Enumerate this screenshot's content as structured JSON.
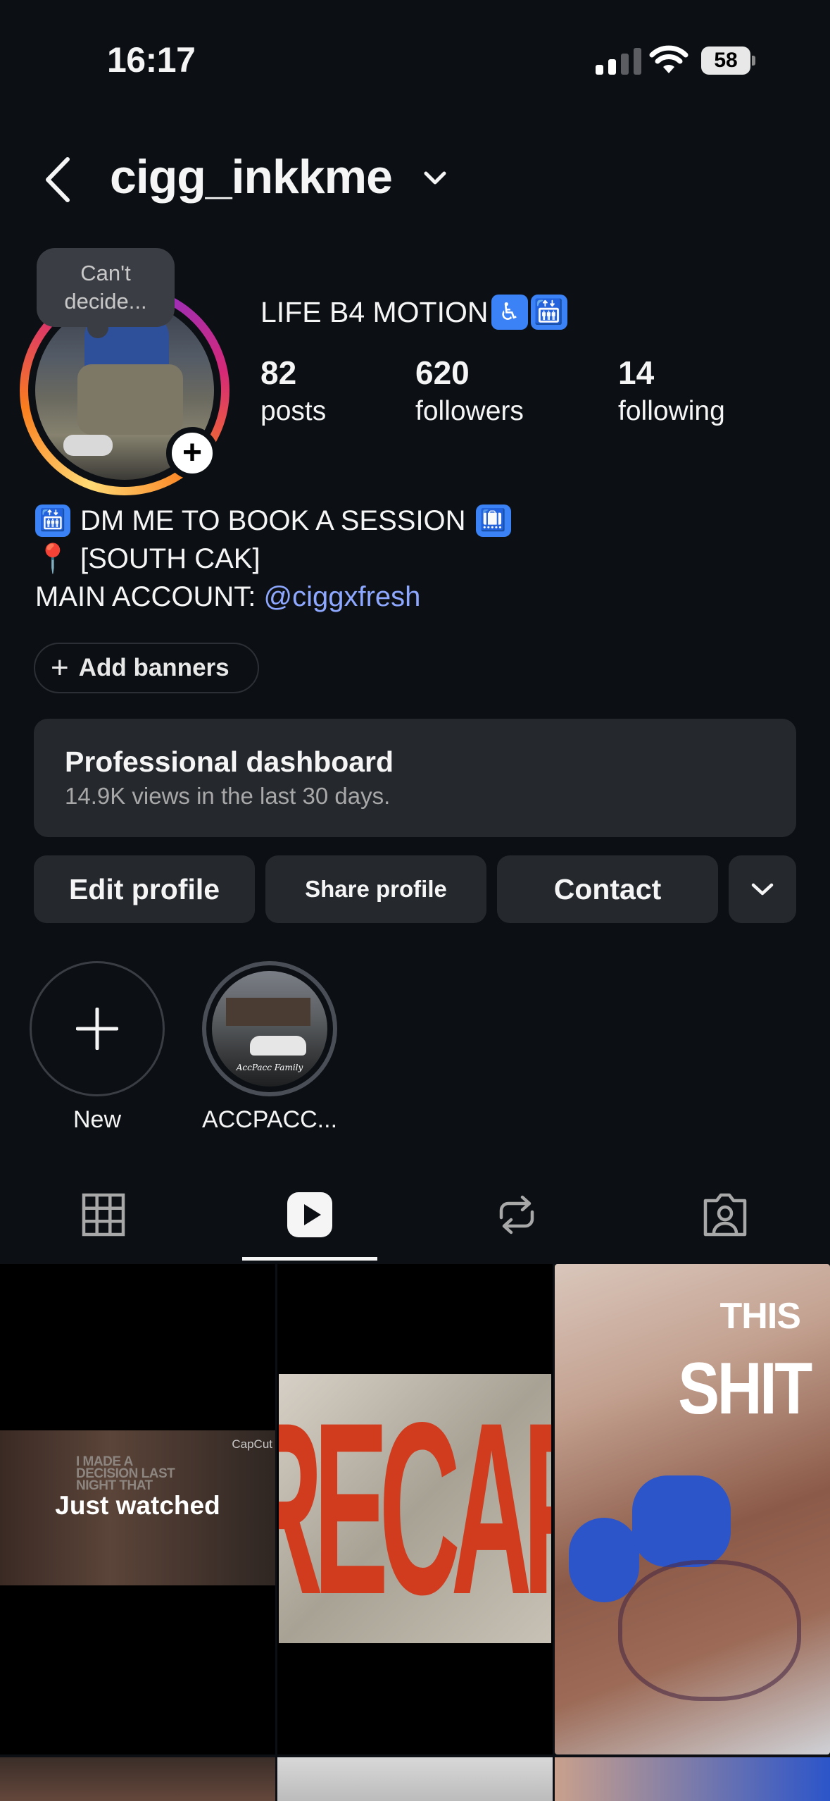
{
  "status_bar": {
    "time": "16:17",
    "battery": "58"
  },
  "header": {
    "username": "cigg_inkkme"
  },
  "note": {
    "text_line1": "Can't",
    "text_line2": "decide..."
  },
  "profile": {
    "display_name": "LIFE B4 MOTION",
    "name_emoji_1": "♿",
    "name_emoji_2": "🛗",
    "stats": [
      {
        "value": "82",
        "label": "posts"
      },
      {
        "value": "620",
        "label": "followers"
      },
      {
        "value": "14",
        "label": "following"
      }
    ],
    "bio": {
      "line1_emoji": "🛗",
      "line1_text": "DM ME TO BOOK A SESSION",
      "line1_emoji_end": "🛄",
      "line2_emoji": "📍",
      "line2_text": "[SOUTH CAK]",
      "line3_prefix": "MAIN ACCOUNT: ",
      "line3_mention": "@ciggxfresh"
    }
  },
  "add_banners": {
    "label": "Add banners"
  },
  "dashboard": {
    "title": "Professional dashboard",
    "subtitle": "14.9K views in the last 30 days."
  },
  "buttons": {
    "edit": "Edit profile",
    "share": "Share profile",
    "contact": "Contact"
  },
  "highlights": [
    {
      "label": "New"
    },
    {
      "label": "ACCPACC...",
      "cover_text": "AccPacc Family"
    }
  ],
  "tabs": {
    "active": "reels"
  },
  "grid": {
    "cell1_overlay": "Just watched",
    "cell1_small_text": "I MADE A DECISION LAST NIGHT THAT",
    "cell1_brand": "CapCut",
    "cell2_text": "RECAP",
    "cell3_line1": "THIS",
    "cell3_line2": "SHIT"
  },
  "colors": {
    "background": "#0c1014",
    "surface": "#25292e",
    "mention": "#8ea8ff",
    "text": "#f5f5f5"
  }
}
